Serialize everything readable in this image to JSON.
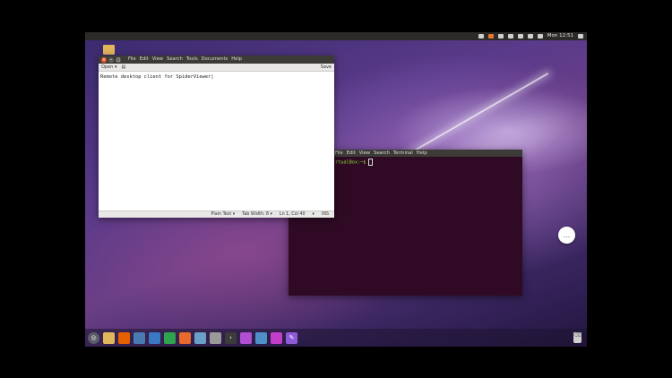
{
  "topbar": {
    "clock": "Mon 12:51"
  },
  "gedit": {
    "menu": [
      "File",
      "Edit",
      "View",
      "Search",
      "Tools",
      "Documents",
      "Help"
    ],
    "toolbar": {
      "open_label": "Open ▾",
      "save_label": "Save"
    },
    "content": "Remote desktop client for SpiderViewer|",
    "status": {
      "syntax": "Plain Text ▾",
      "tab_width": "Tab Width: 8 ▾",
      "position": "Ln 1, Col 40",
      "mode_arrow": "▾",
      "insert_mode": "INS"
    }
  },
  "terminal": {
    "menu": [
      "File",
      "Edit",
      "View",
      "Search",
      "Terminal",
      "Help"
    ],
    "prompt": "rtualBox:~$ "
  },
  "chat": {
    "label": "..."
  },
  "dock": {
    "icons": [
      "apps-icon",
      "files-icon",
      "firefox-icon",
      "screenshot-icon",
      "writer-icon",
      "calc-icon",
      "impress-icon",
      "photos-icon",
      "software-icon",
      "terminal-icon",
      "app-purple-icon",
      "folder-blue-icon",
      "app-magenta-icon",
      "pin-icon"
    ],
    "colors": [
      "#5b5b6a",
      "#e2b65b",
      "#e66000",
      "#4a7ab3",
      "#3b78c4",
      "#2ea44f",
      "#e86a2c",
      "#6aa0c8",
      "#9a9a9a",
      "#3b3b3b",
      "#b04fd0",
      "#4f8fc8",
      "#c03ec8",
      "#8e5ad6"
    ]
  },
  "colors": {
    "accent": "#e95420",
    "terminal_bg": "#300a24",
    "prompt": "#8ae234"
  }
}
